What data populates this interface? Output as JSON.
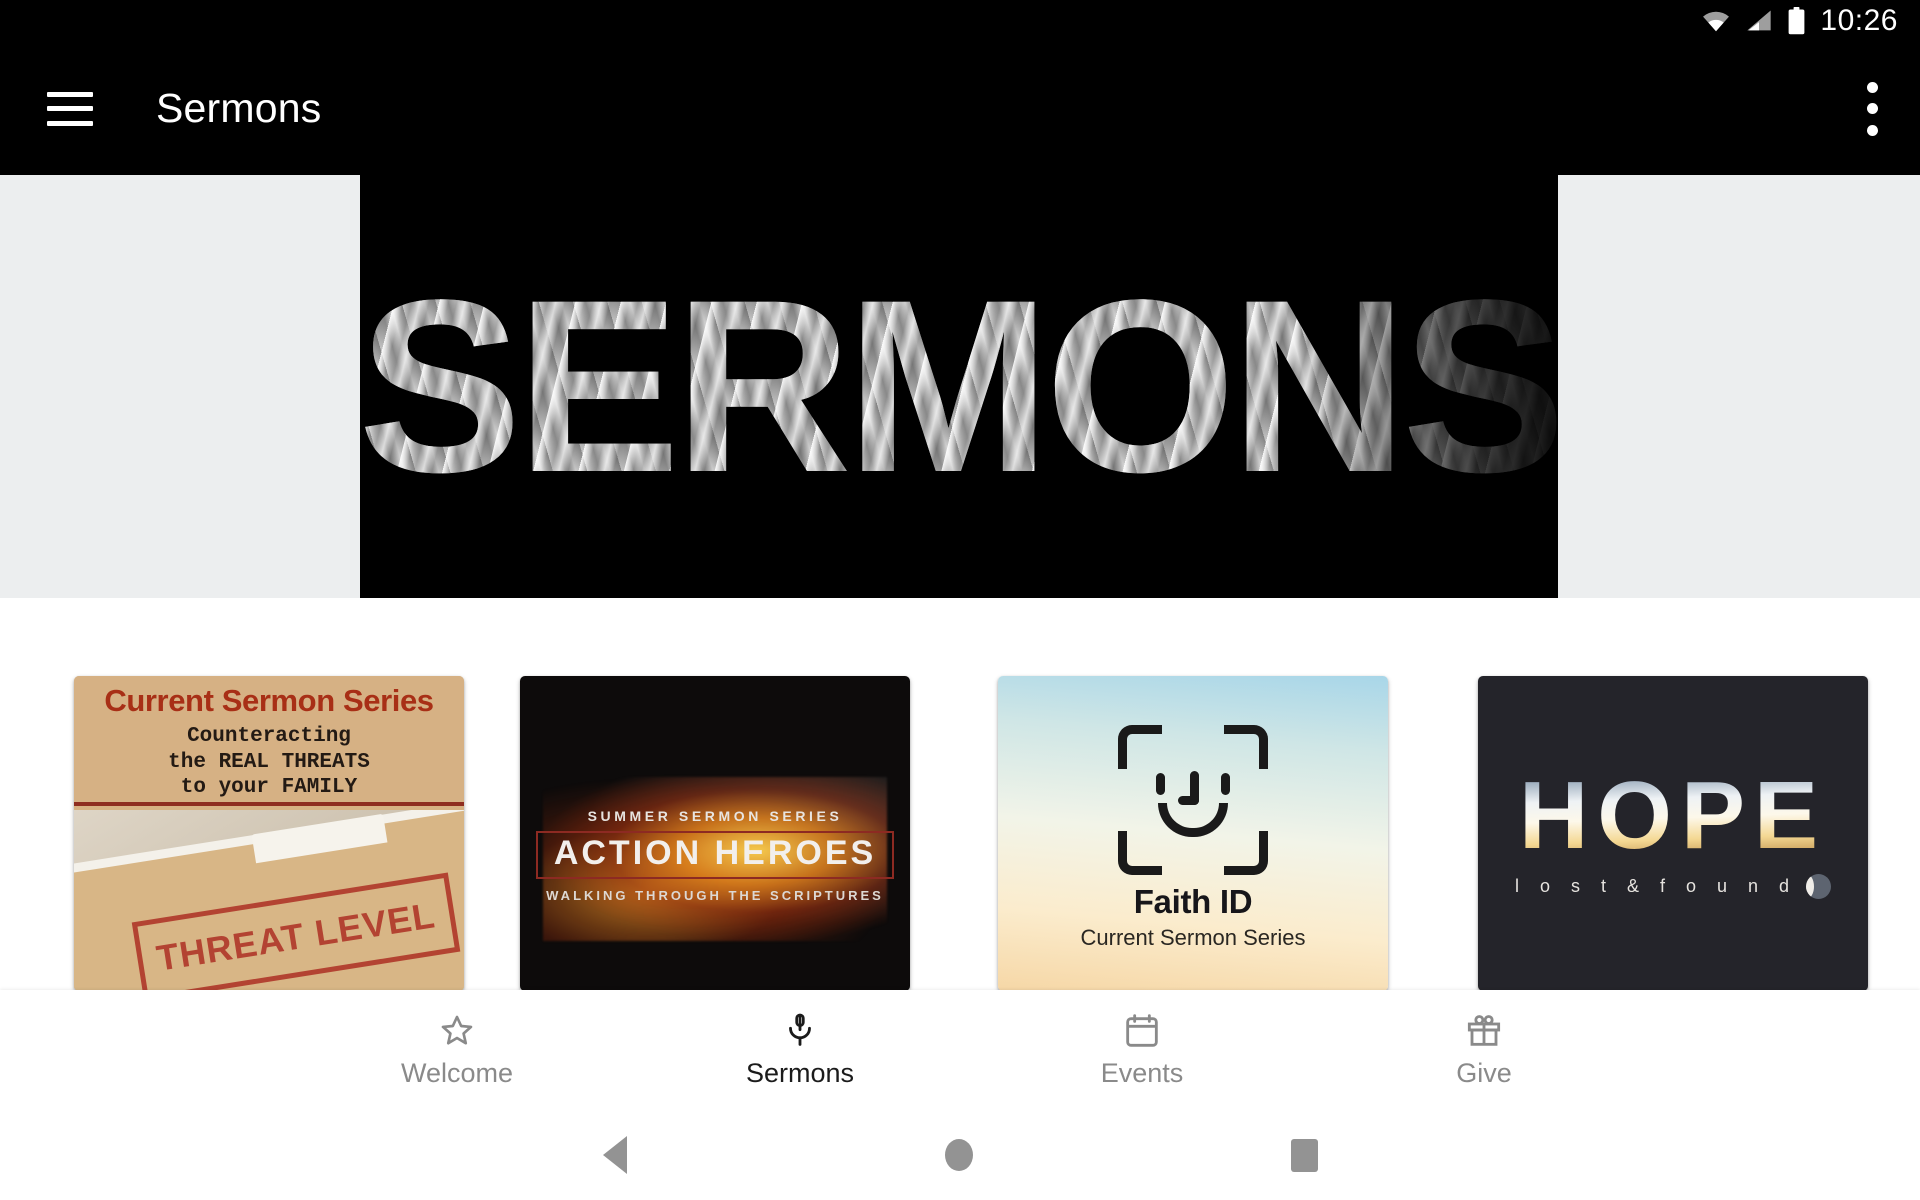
{
  "status_bar": {
    "time": "10:26",
    "icons": [
      "wifi-icon",
      "cell-signal-icon",
      "battery-icon"
    ]
  },
  "app_bar": {
    "menu_icon": "hamburger-menu-icon",
    "title": "Sermons",
    "overflow_icon": "more-vertical-icon"
  },
  "hero": {
    "word": "SERMONS",
    "background_color": "#000000",
    "surround_color": "#ECEEEF",
    "description": "SERMONS wordmark filled with a grayscale photo of raised hands"
  },
  "cards": [
    {
      "name": "threat-level",
      "title": "Current Sermon Series",
      "line1": "Counteracting",
      "line2": "the REAL THREATS",
      "line3": "to your FAMILY",
      "stamp": "THREAT LEVEL",
      "accent_color": "#a82f16",
      "background_color": "#d7b183"
    },
    {
      "name": "action-heroes",
      "eyebrow": "SUMMER SERMON SERIES",
      "title": "ACTION HEROES",
      "subtitle": "WALKING THROUGH THE SCRIPTURES",
      "accent_color": "#8d2a22",
      "background_color": "#0d0b0b"
    },
    {
      "name": "faith-id",
      "icon": "face-id-smiley-icon",
      "title": "Faith ID",
      "subtitle": "Current Sermon Series",
      "background_color": "#cfe6e6"
    },
    {
      "name": "hope-lost-and-found",
      "title": "HOPE",
      "subtitle": "l o s t   &   f o u n d",
      "background_color": "#24242a"
    }
  ],
  "bottom_nav": {
    "items": [
      {
        "label": "Welcome",
        "icon": "star-icon",
        "active": false
      },
      {
        "label": "Sermons",
        "icon": "microphone-icon",
        "active": true
      },
      {
        "label": "Events",
        "icon": "calendar-icon",
        "active": false
      },
      {
        "label": "Give",
        "icon": "gift-icon",
        "active": false
      }
    ],
    "active_color": "#1b1b1b",
    "inactive_color": "#8a8a8a"
  },
  "android_nav": {
    "back": "back-triangle-icon",
    "home": "home-circle-icon",
    "recents": "recents-square-icon",
    "color": "#939393"
  }
}
